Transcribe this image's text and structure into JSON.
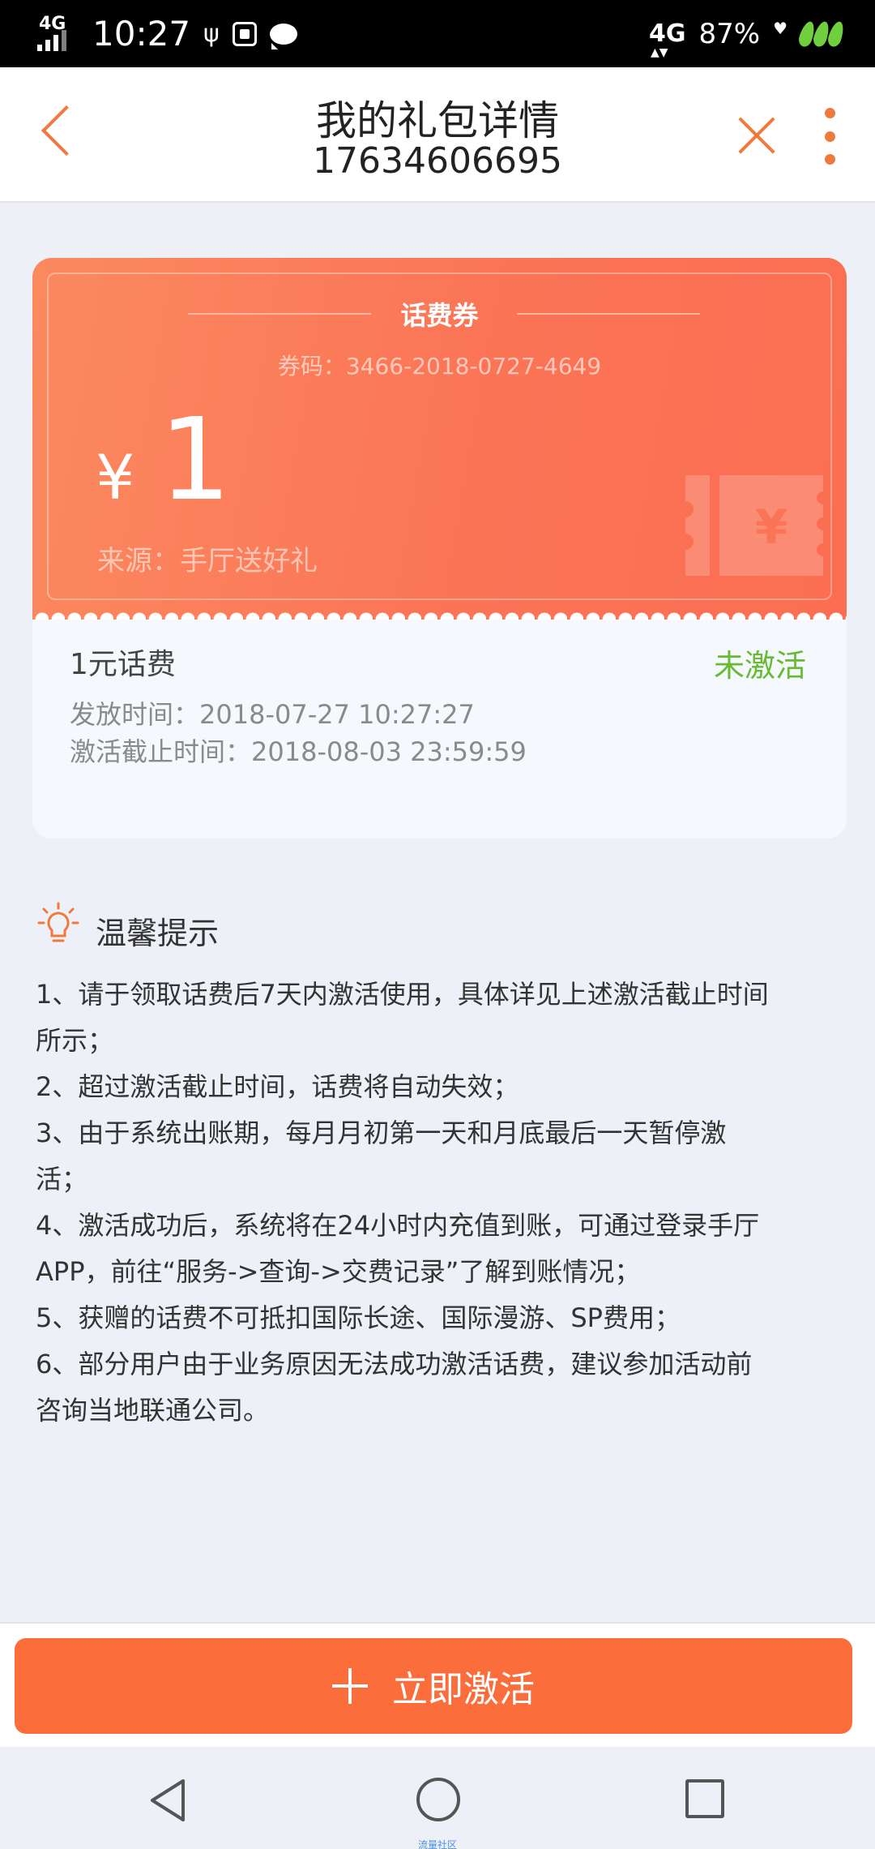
{
  "status_bar": {
    "network_left": "4G",
    "time": "10:27",
    "network_right": "4G",
    "battery": "87%"
  },
  "header": {
    "title": "我的礼包详情",
    "subtitle": "17634606695"
  },
  "coupon": {
    "type": "话费券",
    "code": "券码：3466-2018-0727-4649",
    "currency": "¥",
    "amount": "1",
    "source": "来源：手厅送好礼",
    "ticket_symbol": "¥"
  },
  "details": {
    "name": "1元话费",
    "status": "未激活",
    "issue_time": "发放时间：2018-07-27 10:27:27",
    "deadline": "激活截止时间：2018-08-03 23:59:59"
  },
  "tips": {
    "title": "温馨提示",
    "lines": [
      "1、请于领取话费后7天内激活使用，具体详见上述激活截止时间",
      "所示；",
      "2、超过激活截止时间，话费将自动失效；",
      "3、由于系统出账期，每月月初第一天和月底最后一天暂停激",
      "活；",
      "4、激活成功后，系统将在24小时内充值到账，可通过登录手厅",
      "APP，前往“服务->查询->交费记录”了解到账情况；",
      "5、获赠的话费不可抵扣国际长途、国际漫游、SP费用；",
      "6、部分用户由于业务原因无法成功激活话费，建议参加活动前",
      "咨询当地联通公司。"
    ]
  },
  "action": {
    "activate_label": "立即激活"
  },
  "nav": {
    "watermark": "流量社区"
  },
  "colors": {
    "accent": "#f07a3e",
    "button": "#fb6d3b",
    "status_green": "#66bb33"
  }
}
